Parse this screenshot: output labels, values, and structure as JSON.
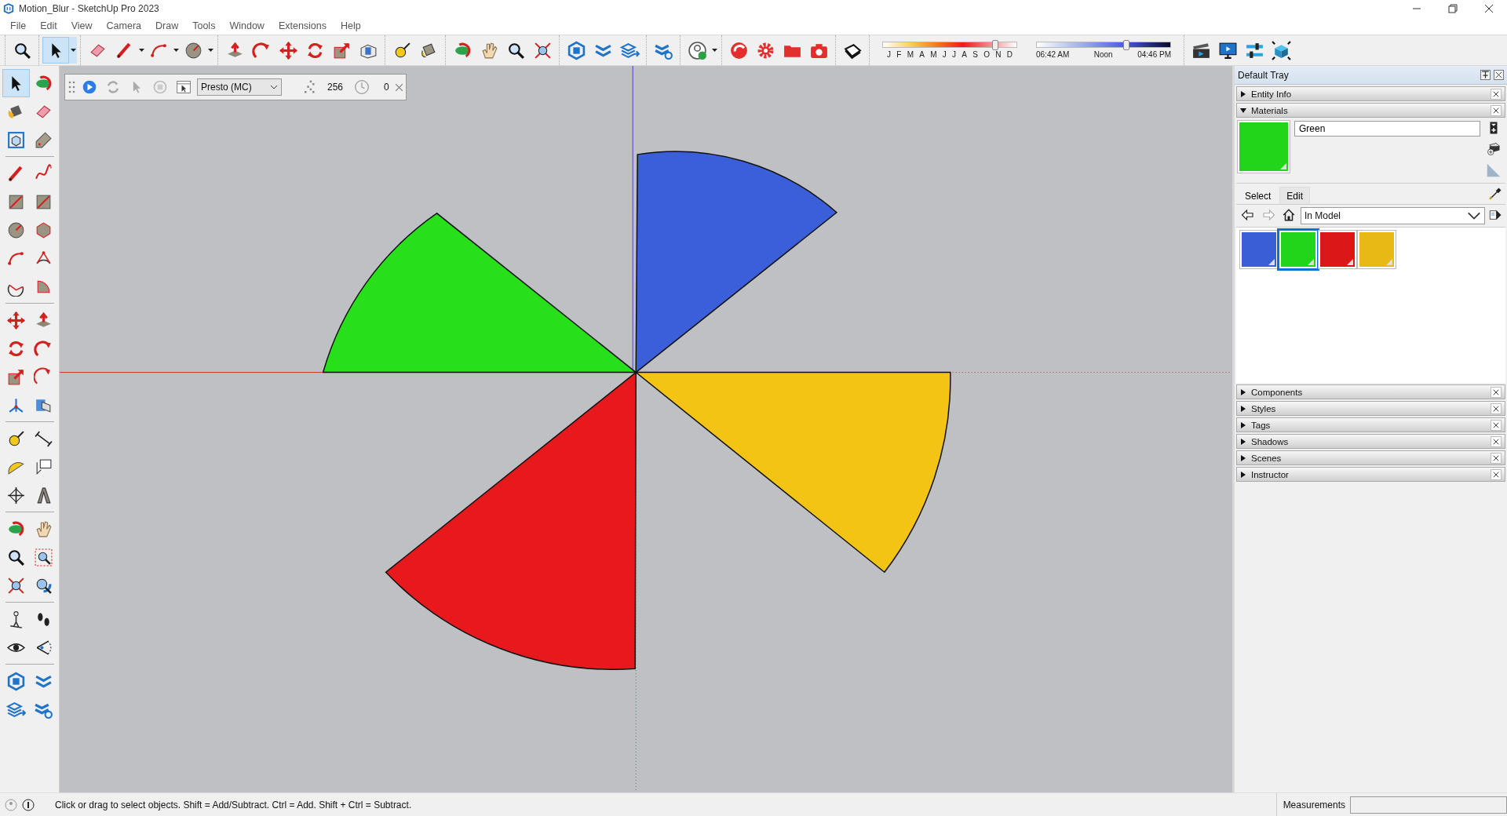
{
  "window": {
    "title": "Motion_Blur - SketchUp Pro 2023"
  },
  "menu": [
    "File",
    "Edit",
    "View",
    "Camera",
    "Draw",
    "Tools",
    "Window",
    "Extensions",
    "Help"
  ],
  "toolbar": {
    "tools": [
      {
        "selected": false
      },
      {
        "selected": true
      },
      {
        "selected": false
      },
      {
        "selected": false
      },
      {
        "selected": false
      },
      {
        "selected": false
      },
      {
        "selected": false
      },
      {
        "selected": false
      },
      {
        "selected": false
      },
      {
        "selected": false
      },
      {
        "selected": false
      },
      {
        "selected": false
      },
      {
        "selected": false
      },
      {
        "selected": false
      },
      {
        "selected": false
      },
      {
        "selected": false
      },
      {
        "selected": false
      },
      {
        "selected": false
      },
      {
        "selected": false
      },
      {
        "selected": false
      },
      {
        "selected": false
      },
      {
        "selected": false
      },
      {
        "selected": false
      },
      {
        "selected": false
      },
      {
        "selected": false
      },
      {
        "selected": false
      },
      {
        "selected": false
      },
      {
        "selected": false
      },
      {
        "selected": false
      },
      {
        "selected": false
      },
      {
        "selected": false
      },
      {
        "selected": false
      }
    ],
    "season": {
      "level": 0.84,
      "months": [
        "J",
        "F",
        "M",
        "A",
        "M",
        "J",
        "J",
        "A",
        "S",
        "O",
        "N",
        "D"
      ]
    },
    "time_of_day": {
      "level": 0.67,
      "labels": [
        "06:42 AM",
        "Noon",
        "04:46 PM"
      ]
    }
  },
  "left_toolbar": {
    "tools": [
      {
        "selected": true
      },
      {
        "selected": false
      },
      {
        "selected": false
      },
      {
        "selected": false
      },
      {
        "selected": false
      },
      {
        "selected": false
      },
      {
        "selected": false
      },
      {
        "selected": false
      },
      {
        "selected": false
      },
      {
        "selected": false
      },
      {
        "selected": false
      },
      {
        "selected": false
      },
      {
        "selected": false
      },
      {
        "selected": false
      },
      {
        "selected": false
      },
      {
        "selected": false
      },
      {
        "selected": false
      },
      {
        "selected": false
      },
      {
        "selected": false
      },
      {
        "selected": false
      },
      {
        "selected": false
      },
      {
        "selected": false
      },
      {
        "selected": false
      },
      {
        "selected": false
      },
      {
        "selected": false
      },
      {
        "selected": false
      },
      {
        "selected": false
      },
      {
        "selected": false
      },
      {
        "selected": false
      },
      {
        "selected": false
      },
      {
        "selected": false
      },
      {
        "selected": false
      },
      {
        "selected": false
      },
      {
        "selected": false
      },
      {
        "selected": false
      },
      {
        "selected": false
      },
      {
        "selected": false
      },
      {
        "selected": false
      },
      {
        "selected": false
      },
      {
        "selected": false
      },
      {
        "selected": false
      },
      {
        "selected": false
      },
      {
        "selected": false
      },
      {
        "selected": false
      }
    ]
  },
  "presto": {
    "mode": "Presto (MC)",
    "samples": "256",
    "time": "0"
  },
  "model": {
    "sectors": [
      {
        "color": "#3a5fd9"
      },
      {
        "color": "#27e01a"
      },
      {
        "color": "#f4c414"
      },
      {
        "color": "#e8191c"
      }
    ]
  },
  "tray": {
    "title": "Default Tray",
    "panels": [
      {
        "title": "Entity Info",
        "expanded": false
      },
      {
        "title": "Materials",
        "expanded": true,
        "kind": "materials"
      },
      {
        "title": "Components",
        "expanded": false
      },
      {
        "title": "Styles",
        "expanded": false
      },
      {
        "title": "Tags",
        "expanded": false
      },
      {
        "title": "Shadows",
        "expanded": false
      },
      {
        "title": "Scenes",
        "expanded": false
      },
      {
        "title": "Instructor",
        "expanded": false
      }
    ]
  },
  "materials": {
    "name": "Green",
    "tabs": [
      {
        "label": "Select",
        "selected": true
      },
      {
        "label": "Edit",
        "selected": false
      }
    ],
    "collection": "In Model",
    "swatches": [
      {
        "color": "#3a5ed6",
        "selected": false
      },
      {
        "color": "#22d41a",
        "selected": true
      },
      {
        "color": "#dc1718",
        "selected": false
      },
      {
        "color": "#e8b915",
        "selected": false
      }
    ]
  },
  "status_bar": {
    "message": "Click or drag to select objects. Shift = Add/Subtract. Ctrl = Add. Shift + Ctrl = Subtract.",
    "measurements_label": "Measurements"
  }
}
